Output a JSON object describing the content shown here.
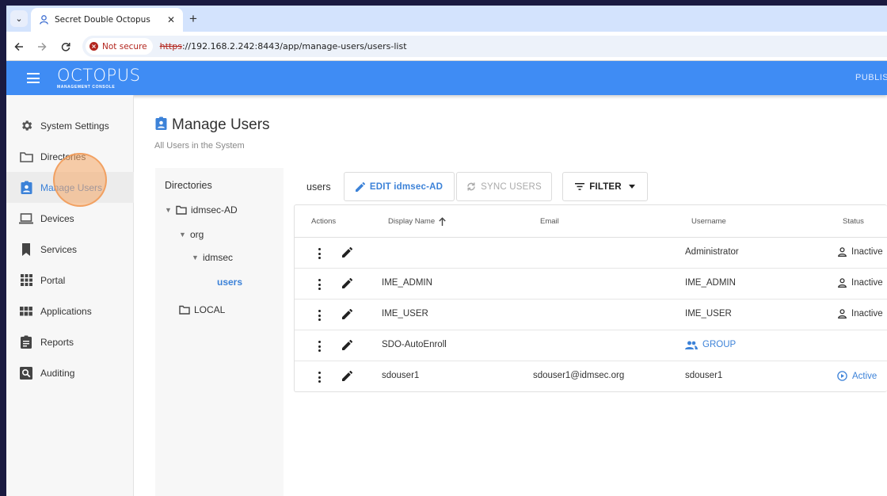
{
  "browser": {
    "tab_title": "Secret Double Octopus",
    "security_label": "Not secure",
    "url_protocol": "https",
    "url_rest": "://192.168.2.242:8443/app/manage-users/users-list"
  },
  "header": {
    "logo_text": "OCTOPUS",
    "logo_subtext": "MANAGEMENT CONSOLE",
    "right_text": "PUBLIS"
  },
  "sidebar": {
    "items": [
      {
        "label": "System Settings",
        "icon": "gear-icon"
      },
      {
        "label": "Directories",
        "icon": "folder-icon"
      },
      {
        "label": "Manage Users",
        "icon": "user-badge-icon",
        "active": true
      },
      {
        "label": "Devices",
        "icon": "laptop-icon"
      },
      {
        "label": "Services",
        "icon": "bookmark-icon"
      },
      {
        "label": "Portal",
        "icon": "grid-icon"
      },
      {
        "label": "Applications",
        "icon": "apps-icon"
      },
      {
        "label": "Reports",
        "icon": "clipboard-icon"
      },
      {
        "label": "Auditing",
        "icon": "search-box-icon"
      }
    ]
  },
  "page": {
    "title": "Manage Users",
    "subtitle": "All Users in the System"
  },
  "directories": {
    "heading": "Directories",
    "tree": [
      {
        "label": "idmsec-AD"
      },
      {
        "label": "org"
      },
      {
        "label": "idmsec"
      },
      {
        "label": "users",
        "selected": true
      },
      {
        "label": "LOCAL"
      }
    ]
  },
  "toolbar": {
    "breadcrumb": "users",
    "edit_label": "EDIT idmsec-AD",
    "sync_label": "SYNC USERS",
    "filter_label": "FILTER"
  },
  "table": {
    "columns": [
      "Actions",
      "Display Name",
      "Email",
      "Username",
      "Status"
    ],
    "rows": [
      {
        "display_name": "",
        "email": "",
        "username": "Administrator",
        "status": "Inactive"
      },
      {
        "display_name": "IME_ADMIN",
        "email": "",
        "username": "IME_ADMIN",
        "status": "Inactive"
      },
      {
        "display_name": "IME_USER",
        "email": "",
        "username": "IME_USER",
        "status": "Inactive"
      },
      {
        "display_name": "SDO-AutoEnroll",
        "email": "",
        "username": "GROUP",
        "status": ""
      },
      {
        "display_name": "sdouser1",
        "email": "sdouser1@idmsec.org",
        "username": "sdouser1",
        "status": "Active"
      }
    ]
  },
  "colors": {
    "header_blue": "#3f8cf4",
    "accent_blue": "#3c82d8",
    "warning_red": "#b3261e"
  }
}
